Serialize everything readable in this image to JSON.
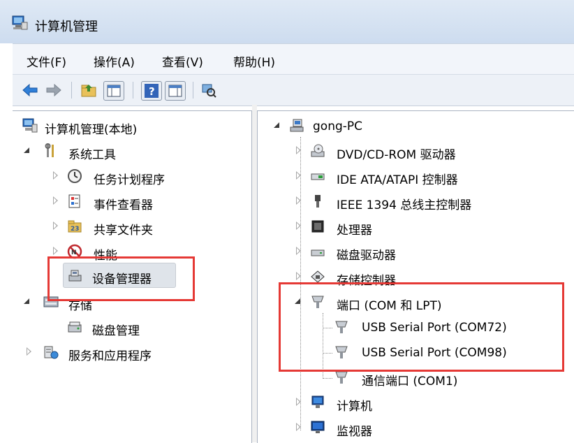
{
  "window": {
    "title": "计算机管理"
  },
  "menu": [
    "文件(F)",
    "操作(A)",
    "查看(V)",
    "帮助(H)"
  ],
  "left_tree": {
    "root": "计算机管理(本地)",
    "system_tools": {
      "label": "系统工具",
      "children": [
        "任务计划程序",
        "事件查看器",
        "共享文件夹",
        "性能",
        "设备管理器"
      ]
    },
    "storage": {
      "label": "存储",
      "children": [
        "磁盘管理"
      ]
    },
    "services": "服务和应用程序"
  },
  "right_tree": {
    "root": "gong-PC",
    "items": [
      "DVD/CD-ROM 驱动器",
      "IDE ATA/ATAPI 控制器",
      "IEEE 1394 总线主控制器",
      "处理器",
      "磁盘驱动器",
      "存储控制器"
    ],
    "ports": {
      "label": "端口 (COM 和 LPT)",
      "children": [
        "USB Serial Port (COM72)",
        "USB Serial Port (COM98)",
        "通信端口 (COM1)"
      ]
    },
    "after": [
      "计算机",
      "监视器"
    ]
  },
  "colors": {
    "highlight": "#e53935",
    "selection": "#dfe4ea"
  }
}
